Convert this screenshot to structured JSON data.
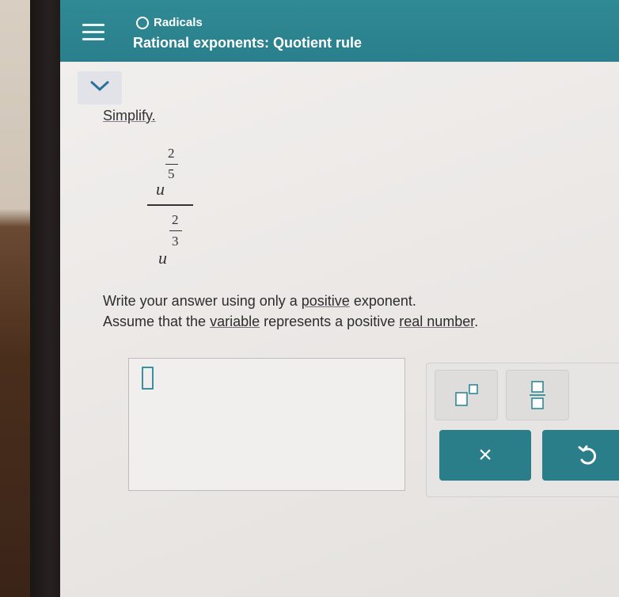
{
  "header": {
    "topic": "Radicals",
    "title": "Rational exponents: Quotient rule"
  },
  "problem": {
    "prompt": "Simplify.",
    "expression": {
      "numerator": {
        "base": "u",
        "exponent_numerator": "2",
        "exponent_denominator": "5"
      },
      "denominator": {
        "base": "u",
        "exponent_numerator": "2",
        "exponent_denominator": "3"
      }
    },
    "instructions_line1": {
      "before": "Write your answer using only a ",
      "link": "positive",
      "after": " exponent."
    },
    "instructions_line2": {
      "before": "Assume that the ",
      "link1": "variable",
      "middle": " represents a positive ",
      "link2": "real number",
      "after": "."
    }
  },
  "answer": {
    "value": ""
  },
  "toolbar": {
    "superscript_icon": "superscript-template-icon",
    "fraction_icon": "fraction-template-icon",
    "clear_label": "×",
    "undo_icon": "undo-icon"
  },
  "colors": {
    "header": "#2f8a95",
    "action_button": "#2a7e8a",
    "template_box": "#2f8a95"
  }
}
